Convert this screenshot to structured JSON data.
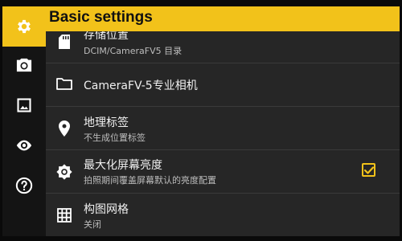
{
  "header": {
    "title": "Basic settings"
  },
  "sidebar": {
    "items": [
      {
        "icon": "gear-icon",
        "active": true
      },
      {
        "icon": "camera-icon",
        "active": false
      },
      {
        "icon": "image-icon",
        "active": false
      },
      {
        "icon": "eye-icon",
        "active": false
      },
      {
        "icon": "help-icon",
        "active": false
      }
    ]
  },
  "settings": {
    "items": [
      {
        "icon": "sd-card-icon",
        "title": "存储位置",
        "subtitle": "DCIM/CameraFV5 目录"
      },
      {
        "icon": "folder-icon",
        "title": "CameraFV-5专业相机",
        "subtitle": ""
      },
      {
        "icon": "location-pin-icon",
        "title": "地理标签",
        "subtitle": "不生成位置标签"
      },
      {
        "icon": "brightness-icon",
        "title": "最大化屏幕亮度",
        "subtitle": "拍照期间覆盖屏幕默认的亮度配置",
        "checked": true
      },
      {
        "icon": "grid-icon",
        "title": "构图网格",
        "subtitle": "关闭"
      }
    ]
  },
  "colors": {
    "accent": "#f2c21a",
    "panel": "#262626",
    "rail": "#141414"
  }
}
